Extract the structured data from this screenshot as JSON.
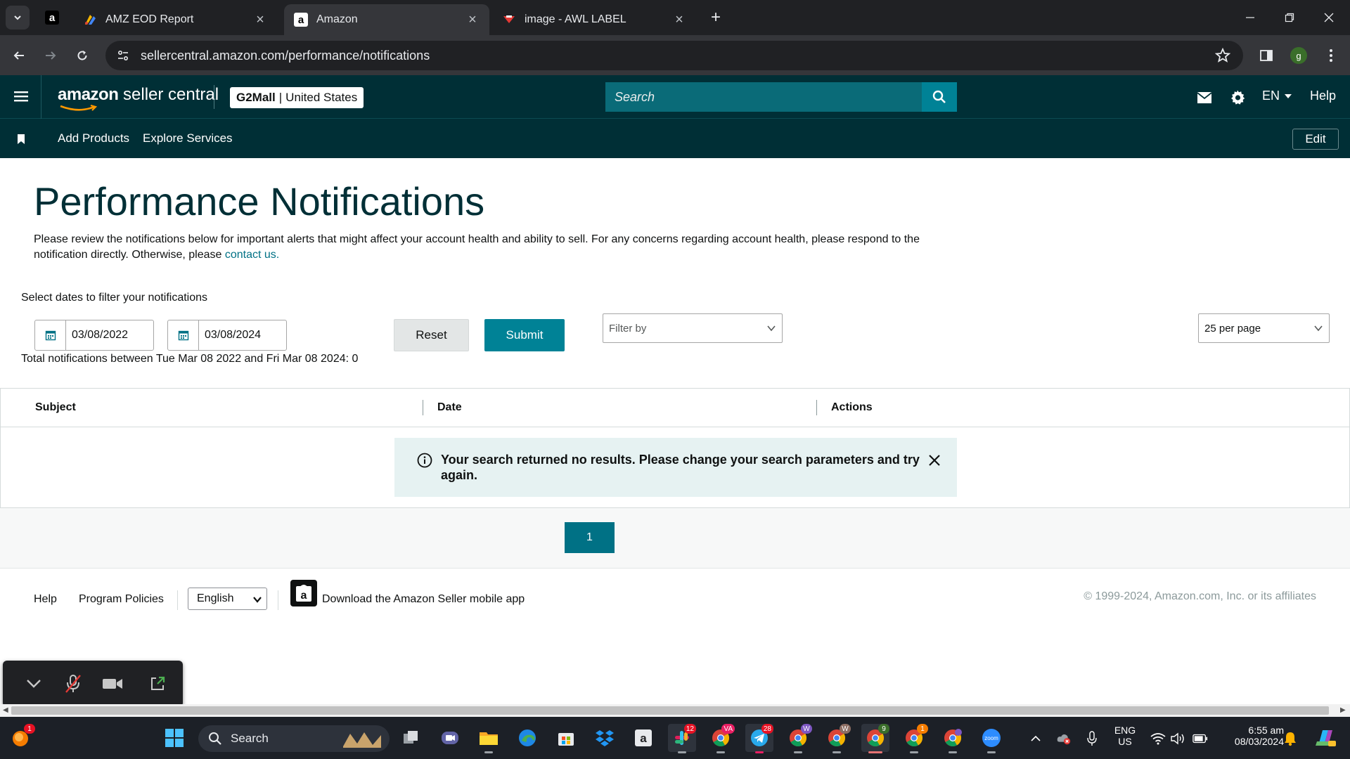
{
  "browser": {
    "tabs": [
      {
        "title": "AMZ EOD Report"
      },
      {
        "title": "Amazon"
      },
      {
        "title": "image - AWL LABEL"
      }
    ],
    "url": "sellercentral.amazon.com/performance/notifications",
    "profile_initial": "g"
  },
  "header": {
    "logo_amazon": "amazon",
    "logo_seller_central": "seller central",
    "store_name": "G2Mall",
    "store_separator": "|",
    "marketplace": "United States",
    "search_placeholder": "Search",
    "language": "EN",
    "help": "Help"
  },
  "subnav": {
    "items": [
      "Add Products",
      "Explore Services"
    ],
    "edit_label": "Edit"
  },
  "page": {
    "title": "Performance Notifications",
    "description": "Please review the notifications below for important alerts that might affect your account health and ability to sell. For any concerns regarding account health, please respond to the notification directly. Otherwise, please ",
    "contact_link": "contact us.",
    "filter_label": "Select dates to filter your notifications",
    "start_date": "03/08/2022",
    "end_date": "03/08/2024",
    "reset_label": "Reset",
    "submit_label": "Submit",
    "filter_by_placeholder": "Filter by",
    "per_page": "25 per page",
    "total_line": "Total notifications between Tue Mar 08 2022 and Fri Mar 08 2024: 0"
  },
  "table": {
    "columns": [
      "Subject",
      "Date",
      "Actions"
    ],
    "no_results": "Your search returned no results. Please change your search parameters and try again."
  },
  "pagination": {
    "current_page": "1"
  },
  "footer": {
    "help": "Help",
    "program_policies": "Program Policies",
    "language": "English",
    "download_app": "Download the Amazon Seller mobile app",
    "copyright": "© 1999-2024, Amazon.com, Inc. or its affiliates"
  },
  "taskbar": {
    "search_label": "Search",
    "lang_top": "ENG",
    "lang_bottom": "US",
    "time": "6:55 am",
    "date": "08/03/2024",
    "badges": {
      "slack": "12",
      "chrome_va": "VA",
      "telegram": "28",
      "chrome_w": "W",
      "chrome_w2": "W",
      "chrome_9": "9",
      "chrome_1": "1",
      "notif_top": "1"
    }
  },
  "colors": {
    "header_bg": "#002f36",
    "accent_teal": "#008296",
    "title_color": "#002f36",
    "link_color": "#007185",
    "alert_bg": "#e6f2f2"
  }
}
